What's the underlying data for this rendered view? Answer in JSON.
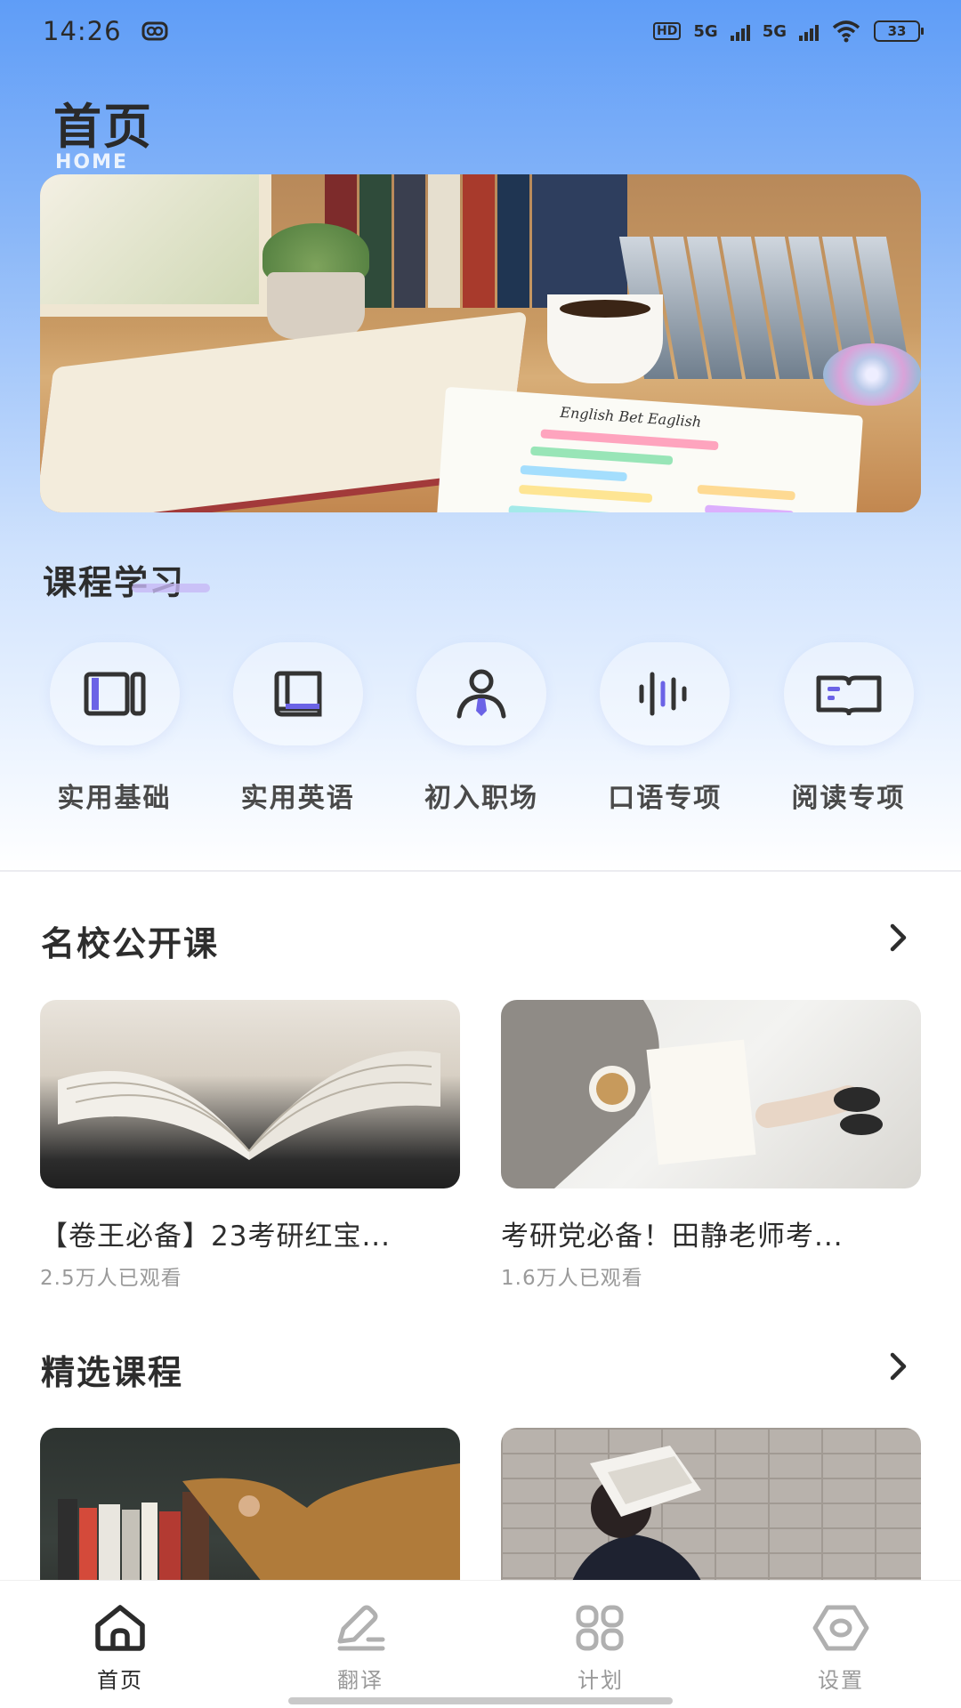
{
  "status_bar": {
    "time": "14:26",
    "hd_label": "HD",
    "network_1": "5G",
    "network_2": "5G",
    "battery": "33"
  },
  "header": {
    "title": "首页",
    "subtitle": "HOME"
  },
  "hero": {
    "notebook_text": "English Bet Eaglish"
  },
  "course_section": {
    "title": "课程学习",
    "categories": [
      {
        "label": "实用基础",
        "icon": "book-columns-icon"
      },
      {
        "label": "实用英语",
        "icon": "book-icon"
      },
      {
        "label": "初入职场",
        "icon": "person-tie-icon"
      },
      {
        "label": "口语专项",
        "icon": "sound-wave-icon"
      },
      {
        "label": "阅读专项",
        "icon": "open-book-icon"
      }
    ]
  },
  "open_course_section": {
    "title": "名校公开课",
    "more_icon": "chevron-right-icon",
    "cards": [
      {
        "title": "【卷王必备】23考研红宝...",
        "views": "2.5万人已观看"
      },
      {
        "title": "考研党必备！田静老师考...",
        "views": "1.6万人已观看"
      }
    ]
  },
  "featured_section": {
    "title": "精选课程",
    "more_icon": "chevron-right-icon"
  },
  "bottom_nav": {
    "items": [
      {
        "label": "首页",
        "icon": "home-icon",
        "active": true
      },
      {
        "label": "翻译",
        "icon": "pen-icon",
        "active": false
      },
      {
        "label": "计划",
        "icon": "grid-icon",
        "active": false
      },
      {
        "label": "设置",
        "icon": "settings-hexagon-icon",
        "active": false
      }
    ]
  },
  "colors": {
    "accent": "#6b63e6",
    "icon_dark": "#3a3a3a",
    "inactive": "#9a9a9a",
    "gradient_top": "#5f9df7"
  }
}
